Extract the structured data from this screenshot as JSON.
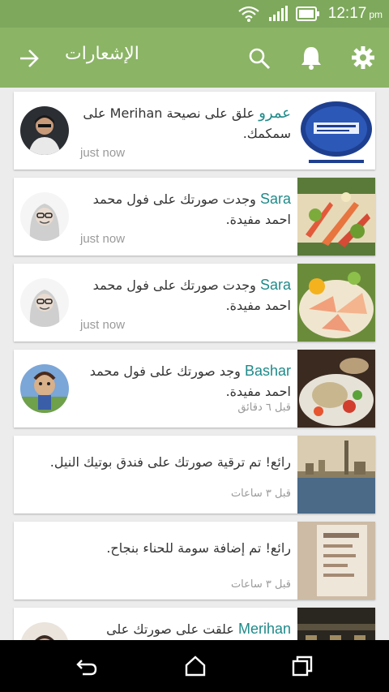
{
  "status_bar": {
    "time": "12:17",
    "ampm": "pm"
  },
  "toolbar": {
    "title": "الإشعارات"
  },
  "colors": {
    "toolbar": "#8bb465",
    "status_bar": "#7ea85c",
    "name_accent": "#1f8a8a"
  },
  "notifications": [
    {
      "name": "عمرو",
      "text": "علق على نصيحة Merihan على سمكمك.",
      "time": "just now"
    },
    {
      "name": "Sara",
      "text": "وجدت صورتك على فول محمد احمد مفيدة.",
      "time": "just now"
    },
    {
      "name": "Sara",
      "text": "وجدت صورتك على فول محمد احمد مفيدة.",
      "time": "just now"
    },
    {
      "name": "Bashar",
      "text": "وجد صورتك على فول محمد احمد مفيدة.",
      "time": "قبل ٦ دقائق"
    },
    {
      "name": "",
      "text": "رائع! تم ترقية صورتك على فندق بوتيك النيل.",
      "time": "قبل ٣ ساعات"
    },
    {
      "name": "",
      "text": "رائع! تم إضافة سومة للحناء بنجاح.",
      "time": "قبل ٣ ساعات"
    },
    {
      "name": "Merihan",
      "text": "علقت على صورتك على قهوة",
      "time": ""
    }
  ]
}
